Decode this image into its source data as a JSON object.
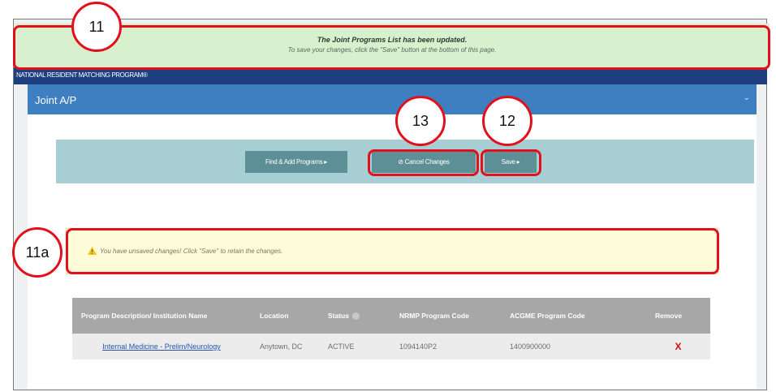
{
  "notification": {
    "title": "The Joint Programs List has been updated.",
    "subtitle": "To save your changes, click the \"Save\" button at the bottom of this page."
  },
  "nav": {
    "title": "NATIONAL RESIDENT MATCHING PROGRAM®"
  },
  "panel": {
    "title": "Joint A/P",
    "collapse_icon": "chevron-down-icon"
  },
  "toolbar": {
    "find_label": "Find & Add Programs ▸",
    "cancel_label": "⊘ Cancel Changes",
    "save_label": "Save ▸"
  },
  "warning": {
    "icon": "warning-icon",
    "text": "You have unsaved changes! Click \"Save\" to retain the changes."
  },
  "table": {
    "headers": [
      "Program Description/ Institution Name",
      "Location",
      "Status",
      "NRMP Program Code",
      "ACGME Program Code",
      "Remove"
    ],
    "rows": [
      {
        "program": "Internal Medicine - Prelim/Neurology",
        "location": "Anytown, DC",
        "status": "ACTIVE",
        "nrmp_code": "1094140P2",
        "acgme_code": "1400900000",
        "remove": "X"
      }
    ]
  },
  "callouts": {
    "c11": "11",
    "c11a": "11a",
    "c12": "12",
    "c13": "13"
  },
  "colors": {
    "callout_red": "#e3101c",
    "banner_green": "#d7f0cd",
    "nav_blue": "#1d3f80",
    "panel_header_blue": "#3d7fc1",
    "button_teal": "#5d8f96",
    "toolbar_bg": "#a7cfd3",
    "warning_bg": "#fffdd9",
    "remove_red": "#d20f0f"
  }
}
